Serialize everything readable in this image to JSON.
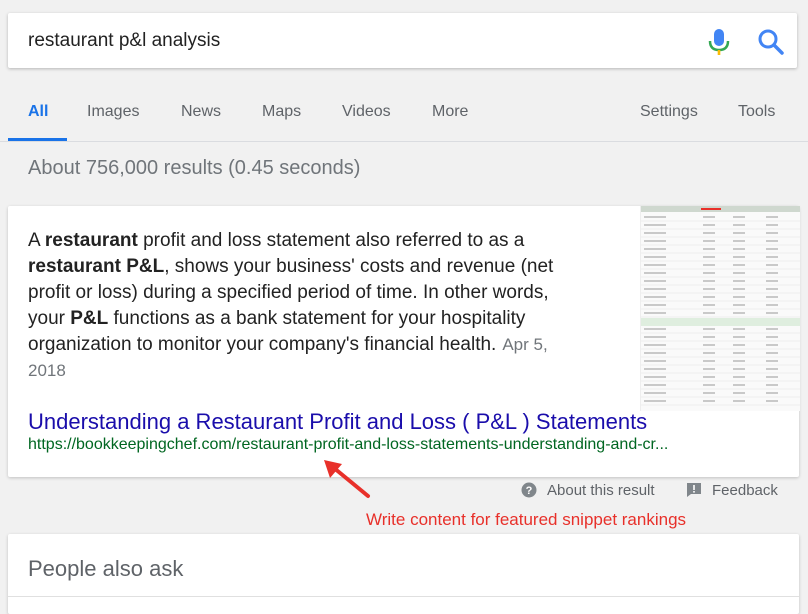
{
  "search": {
    "query": "restaurant p&l analysis"
  },
  "tabs": [
    {
      "label": "All",
      "active": true
    },
    {
      "label": "Images"
    },
    {
      "label": "News"
    },
    {
      "label": "Maps"
    },
    {
      "label": "Videos"
    },
    {
      "label": "More"
    }
  ],
  "tools": {
    "settings": "Settings",
    "tools": "Tools"
  },
  "stats": "About 756,000 results (0.45 seconds)",
  "snippet": {
    "text_parts": [
      {
        "t": "A ",
        "b": false
      },
      {
        "t": "restaurant",
        "b": true
      },
      {
        "t": " profit and loss statement also referred to as a ",
        "b": false
      },
      {
        "t": "restaurant P&L",
        "b": true
      },
      {
        "t": ", shows your business' costs and revenue (net profit or loss) during a specified period of time. In other words, your ",
        "b": false
      },
      {
        "t": "P&L",
        "b": true
      },
      {
        "t": " functions as a bank statement for your hospitality organization to monitor your company's financial health.",
        "b": false
      }
    ],
    "date": "Apr 5, 2018",
    "title": "Understanding a Restaurant Profit and Loss ( P&L ) Statements",
    "url": "https://bookkeepingchef.com/restaurant-profit-and-loss-statements-understanding-and-cr..."
  },
  "about_result": "About this result",
  "feedback": "Feedback",
  "annotation": "Write content for featured snippet rankings",
  "people_also_ask": "People also ask",
  "colors": {
    "link": "#1a0dab",
    "url": "#006621",
    "accent": "#1a73e8",
    "annotation": "#e8302a"
  }
}
